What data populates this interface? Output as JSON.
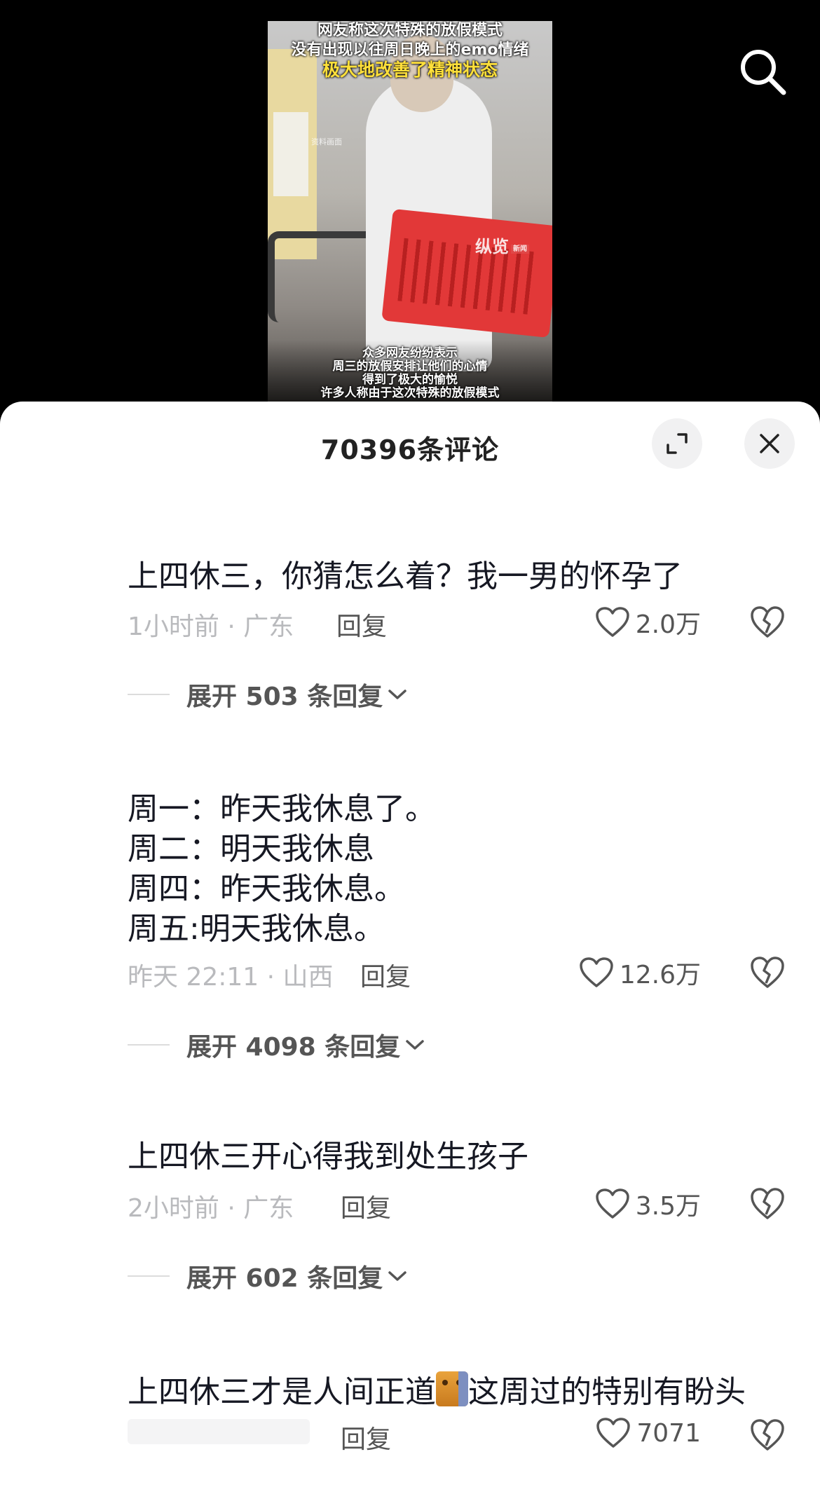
{
  "video": {
    "caption_top": [
      "网友称这次特殊的放假模式",
      "没有出现以往周日晚上的emo情绪"
    ],
    "caption_highlight": "极大地改善了精神状态",
    "small_label": "资料画面",
    "watermark": "纵览",
    "watermark_tag": "新闻",
    "caption_bottom": [
      "众多网友纷纷表示",
      "周三的放假安排让他们的心情",
      "得到了极大的愉悦",
      "许多人称由于这次特殊的放假模式"
    ]
  },
  "comments_panel": {
    "title": "70396条评论"
  },
  "comments": [
    {
      "lines": [
        "上四休三，你猜怎么着？我一男的怀孕了"
      ],
      "meta": "1小时前 · 广东",
      "reply_label": "回复",
      "likes": "2.0万",
      "expand_label": "展开 503 条回复"
    },
    {
      "lines": [
        "周一：昨天我休息了。",
        "周二：明天我休息",
        "周四：昨天我休息。",
        "周五:明天我休息。"
      ],
      "meta": "昨天 22:11 · 山西",
      "reply_label": "回复",
      "likes": "12.6万",
      "expand_label": "展开 4098 条回复"
    },
    {
      "lines": [
        "上四休三开心得我到处生孩子"
      ],
      "meta": "2小时前 · 广东",
      "reply_label": "回复",
      "likes": "3.5万",
      "expand_label": "展开 602 条回复"
    },
    {
      "text_before": "上四休三才是人间正道",
      "text_after": "这周过的特别有盼头",
      "reply_label": "回复",
      "likes": "7071"
    }
  ],
  "icons": {
    "search": "search-icon",
    "expand": "expand-icon",
    "close": "close-icon",
    "like": "heart-icon",
    "dislike": "broken-heart-icon",
    "chevron": "chevron-down-icon"
  }
}
